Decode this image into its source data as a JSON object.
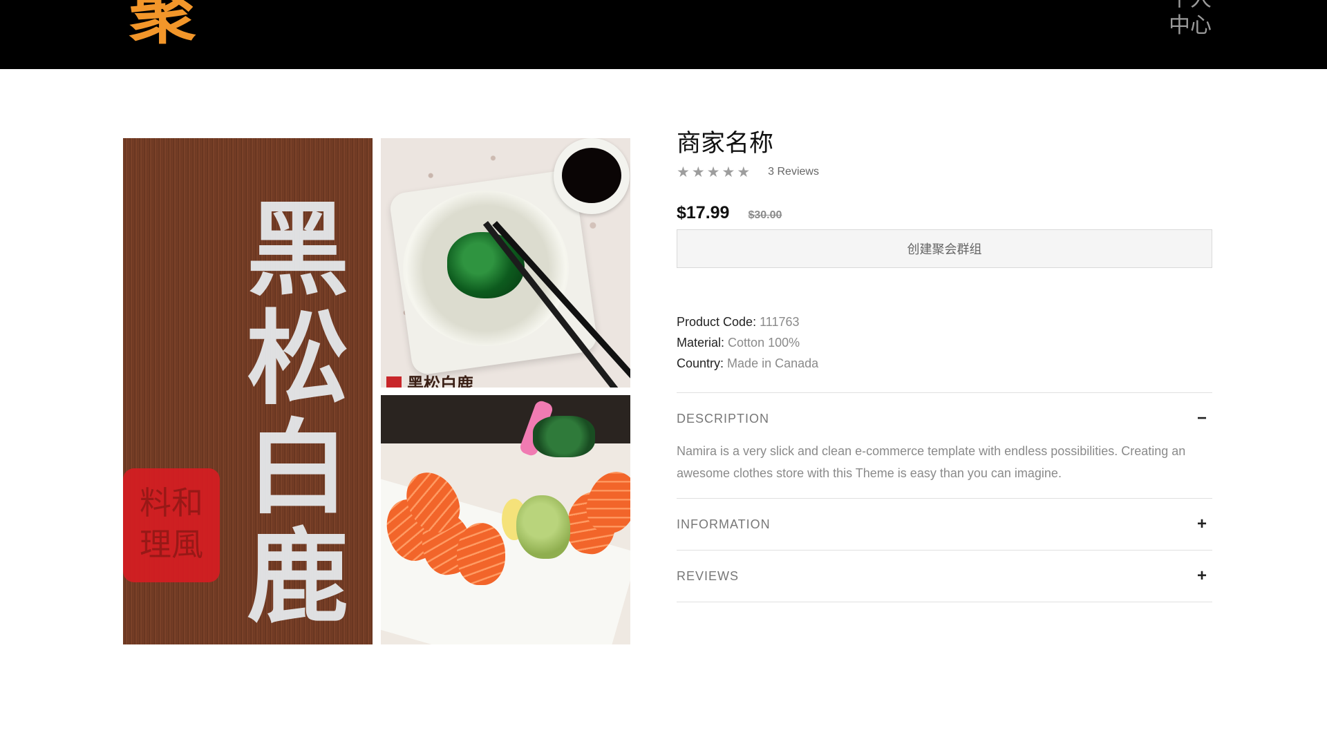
{
  "header": {
    "logo_text": "聚",
    "account_label": "个人中心"
  },
  "gallery": {
    "main_calligraphy": "黑松白鹿",
    "seal_text": "料和理風",
    "side_brand": "黑松白鹿"
  },
  "product": {
    "title": "商家名称",
    "stars": 5,
    "reviews_text": "3 Reviews",
    "price": "$17.99",
    "old_price": "$30.00",
    "group_button": "创建聚会群组",
    "specs": [
      {
        "label": "Product Code:",
        "value": "111763"
      },
      {
        "label": "Material:",
        "value": "Cotton 100%"
      },
      {
        "label": "Country:",
        "value": "Made in Canada"
      }
    ],
    "accordion": [
      {
        "title": "DESCRIPTION",
        "toggle": "−",
        "expanded": true,
        "body": "Namira is a very slick and clean e-commerce template with endless possibilities. Creating an awesome clothes store with this Theme is easy than you can imagine."
      },
      {
        "title": "INFORMATION",
        "toggle": "+",
        "expanded": false
      },
      {
        "title": "REVIEWS",
        "toggle": "+",
        "expanded": false
      }
    ]
  },
  "colors": {
    "header_bg": "#000000",
    "logo": "#f2962a",
    "star": "#9d9d9d",
    "muted_text": "#8a8a8a"
  }
}
